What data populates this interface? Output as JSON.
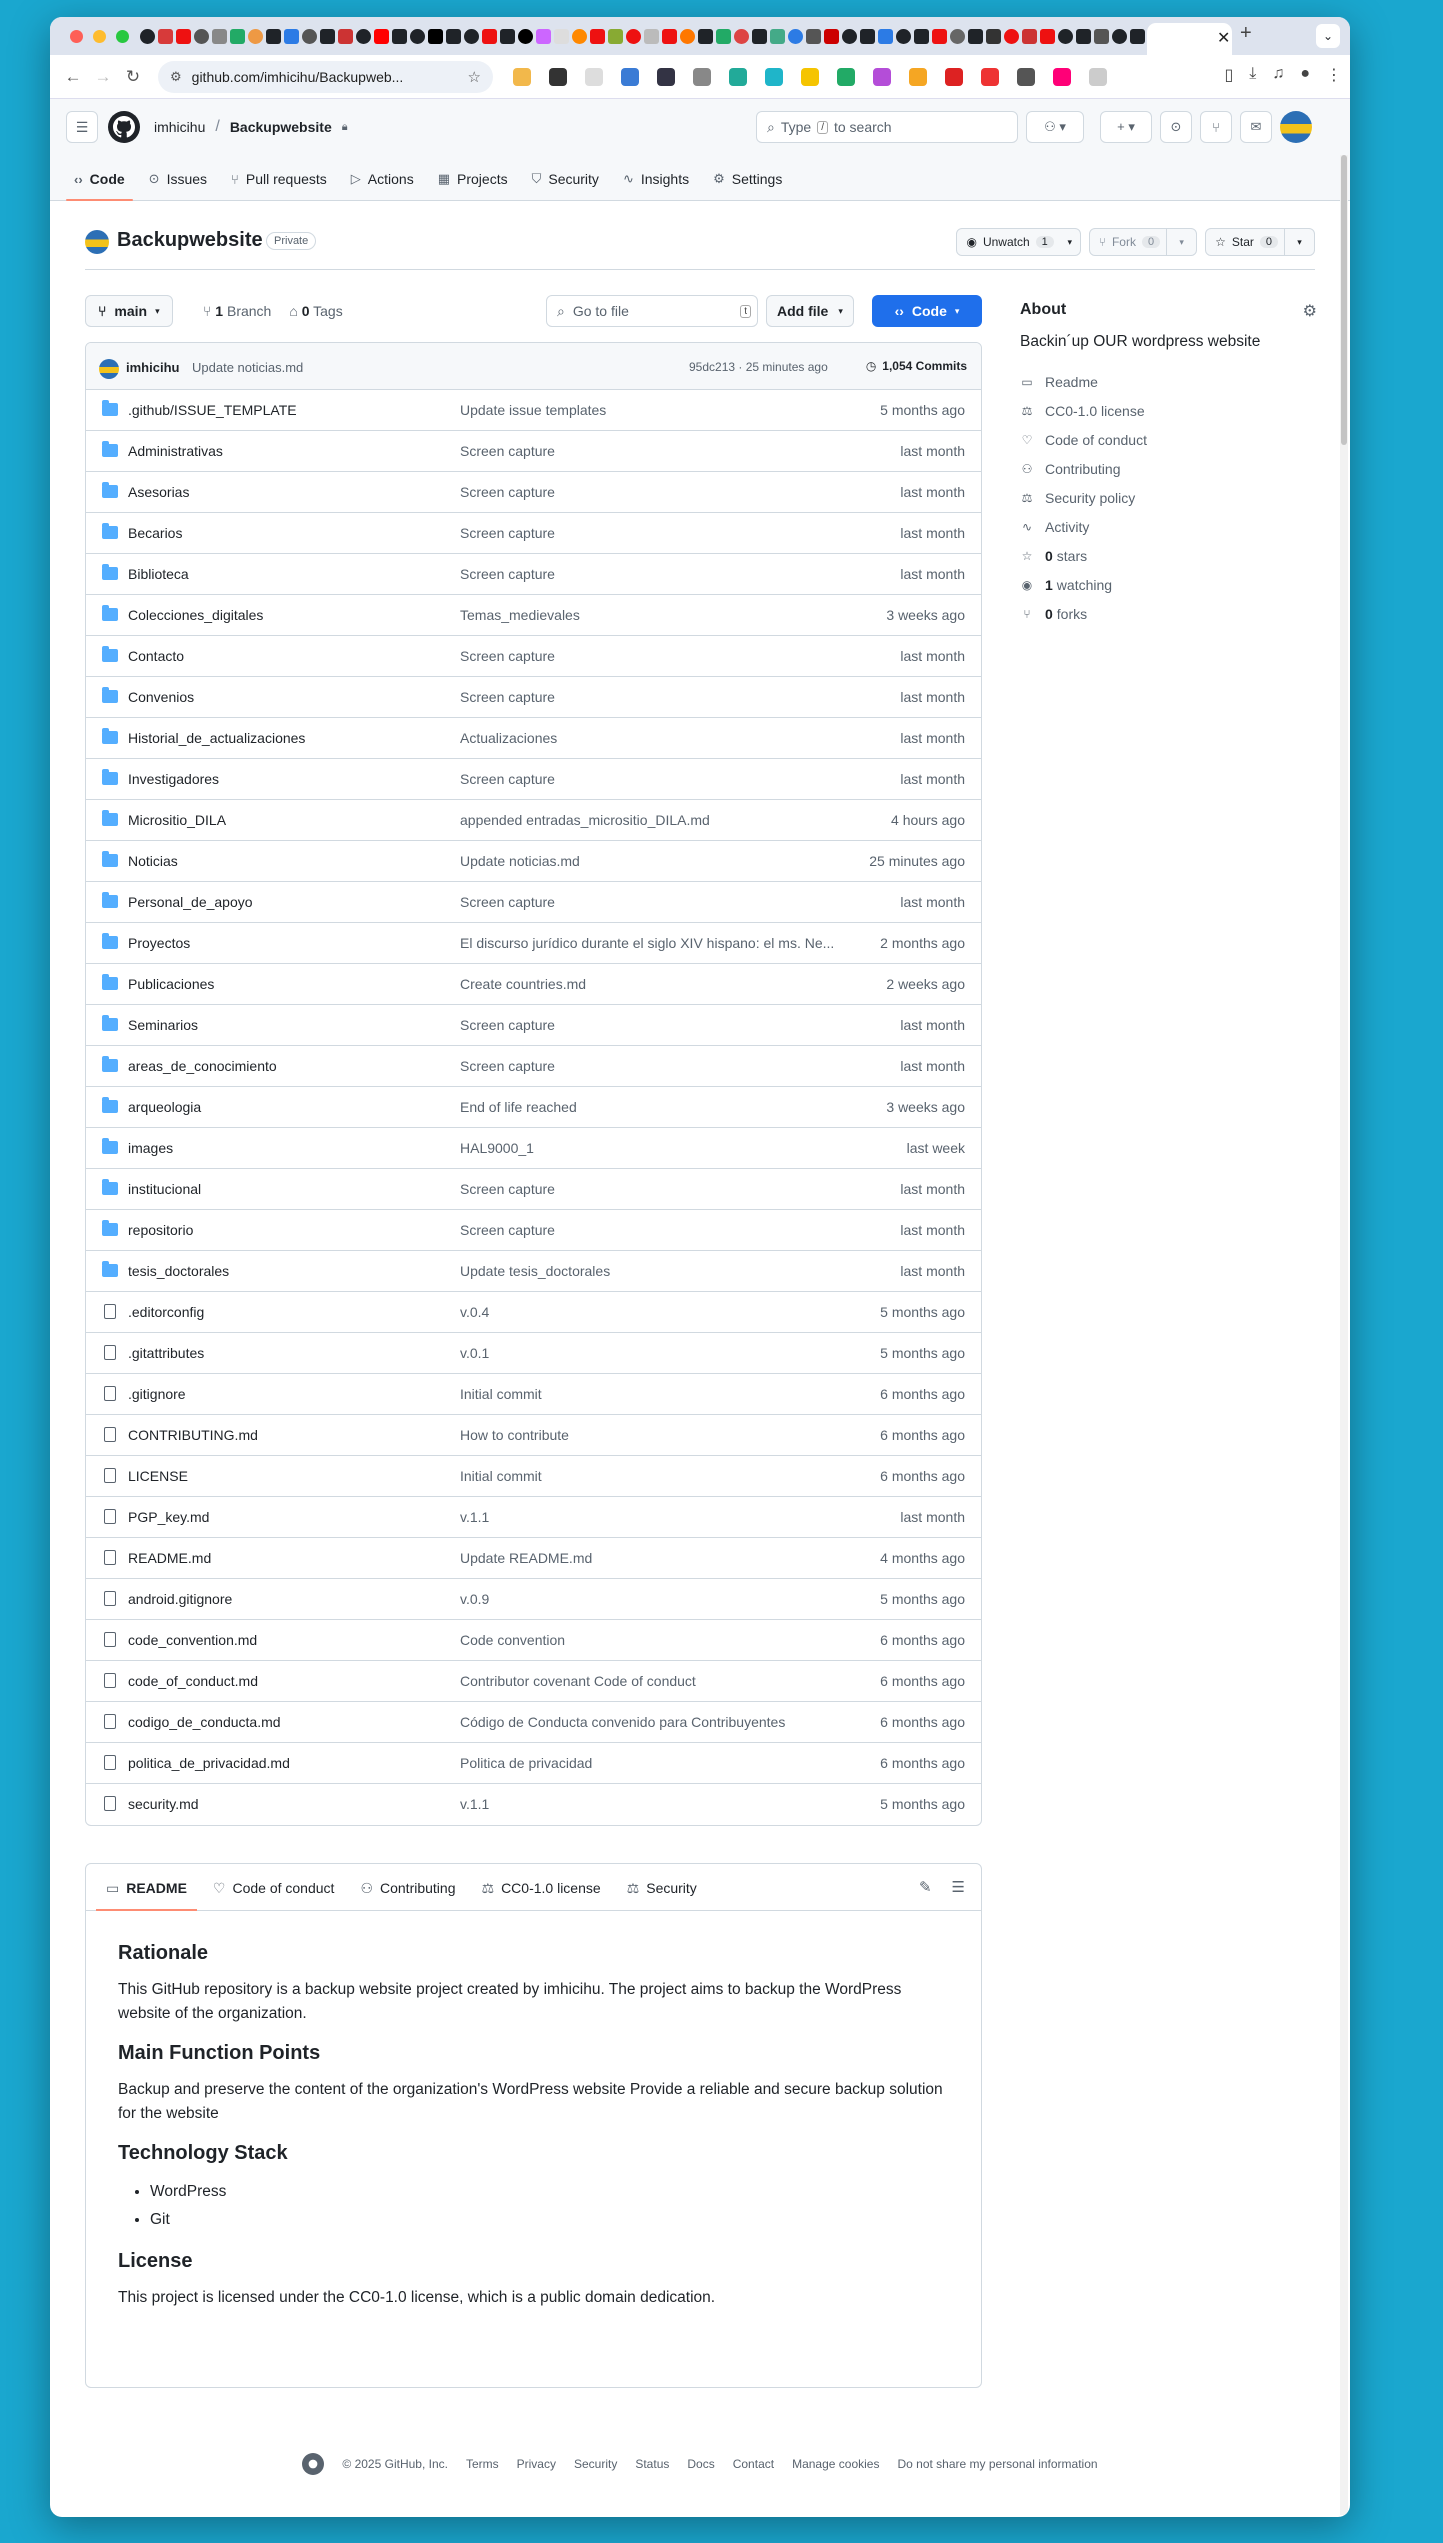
{
  "browser": {
    "url": "github.com/imhicihu/Backupweb...",
    "tab_close": "✕",
    "new_tab": "+"
  },
  "header": {
    "owner": "imhicihu",
    "separator": "/",
    "repo": "Backupwebsite",
    "search_prefix": "Type",
    "search_key": "/",
    "search_suffix": "to search"
  },
  "repo_nav": [
    "Code",
    "Issues",
    "Pull requests",
    "Actions",
    "Projects",
    "Security",
    "Insights",
    "Settings"
  ],
  "repo": {
    "name": "Backupwebsite",
    "visibility": "Private",
    "unwatch_label": "Unwatch",
    "watch_count": "1",
    "fork_label": "Fork",
    "fork_count": "0",
    "star_label": "Star",
    "star_count": "0"
  },
  "actions": {
    "branch": "main",
    "branches_count": "1",
    "branches_label": "Branch",
    "tags_count": "0",
    "tags_label": "Tags",
    "goto_placeholder": "Go to file",
    "goto_key": "t",
    "add_file": "Add file",
    "code": "Code"
  },
  "commit": {
    "user": "imhicihu",
    "message": "Update noticias.md",
    "hash_time": "95dc213 · 25 minutes ago",
    "commits": "1,054 Commits"
  },
  "files": [
    {
      "type": "dir",
      "name": ".github/ISSUE_TEMPLATE",
      "msg": "Update issue templates",
      "time": "5 months ago"
    },
    {
      "type": "dir",
      "name": "Administrativas",
      "msg": "Screen capture",
      "time": "last month"
    },
    {
      "type": "dir",
      "name": "Asesorias",
      "msg": "Screen capture",
      "time": "last month"
    },
    {
      "type": "dir",
      "name": "Becarios",
      "msg": "Screen capture",
      "time": "last month"
    },
    {
      "type": "dir",
      "name": "Biblioteca",
      "msg": "Screen capture",
      "time": "last month"
    },
    {
      "type": "dir",
      "name": "Colecciones_digitales",
      "msg": "Temas_medievales",
      "time": "3 weeks ago"
    },
    {
      "type": "dir",
      "name": "Contacto",
      "msg": "Screen capture",
      "time": "last month"
    },
    {
      "type": "dir",
      "name": "Convenios",
      "msg": "Screen capture",
      "time": "last month"
    },
    {
      "type": "dir",
      "name": "Historial_de_actualizaciones",
      "msg": "Actualizaciones",
      "time": "last month"
    },
    {
      "type": "dir",
      "name": "Investigadores",
      "msg": "Screen capture",
      "time": "last month"
    },
    {
      "type": "dir",
      "name": "Micrositio_DILA",
      "msg": "appended entradas_micrositio_DILA.md",
      "time": "4 hours ago"
    },
    {
      "type": "dir",
      "name": "Noticias",
      "msg": "Update noticias.md",
      "time": "25 minutes ago"
    },
    {
      "type": "dir",
      "name": "Personal_de_apoyo",
      "msg": "Screen capture",
      "time": "last month"
    },
    {
      "type": "dir",
      "name": "Proyectos",
      "msg": "El discurso jurídico durante el siglo XIV hispano: el ms. Ne...",
      "time": "2 months ago"
    },
    {
      "type": "dir",
      "name": "Publicaciones",
      "msg": "Create countries.md",
      "time": "2 weeks ago"
    },
    {
      "type": "dir",
      "name": "Seminarios",
      "msg": "Screen capture",
      "time": "last month"
    },
    {
      "type": "dir",
      "name": "areas_de_conocimiento",
      "msg": "Screen capture",
      "time": "last month"
    },
    {
      "type": "dir",
      "name": "arqueologia",
      "msg": "End of life reached",
      "time": "3 weeks ago"
    },
    {
      "type": "dir",
      "name": "images",
      "msg": "HAL9000_1",
      "time": "last week"
    },
    {
      "type": "dir",
      "name": "institucional",
      "msg": "Screen capture",
      "time": "last month"
    },
    {
      "type": "dir",
      "name": "repositorio",
      "msg": "Screen capture",
      "time": "last month"
    },
    {
      "type": "dir",
      "name": "tesis_doctorales",
      "msg": "Update tesis_doctorales",
      "time": "last month"
    },
    {
      "type": "file",
      "name": ".editorconfig",
      "msg": "v.0.4",
      "time": "5 months ago"
    },
    {
      "type": "file",
      "name": ".gitattributes",
      "msg": "v.0.1",
      "time": "5 months ago"
    },
    {
      "type": "file",
      "name": ".gitignore",
      "msg": "Initial commit",
      "time": "6 months ago"
    },
    {
      "type": "file",
      "name": "CONTRIBUTING.md",
      "msg": "How to contribute",
      "time": "6 months ago"
    },
    {
      "type": "file",
      "name": "LICENSE",
      "msg": "Initial commit",
      "time": "6 months ago"
    },
    {
      "type": "file",
      "name": "PGP_key.md",
      "msg": "v.1.1",
      "time": "last month"
    },
    {
      "type": "file",
      "name": "README.md",
      "msg": "Update README.md",
      "time": "4 months ago"
    },
    {
      "type": "file",
      "name": "android.gitignore",
      "msg": "v.0.9",
      "time": "5 months ago"
    },
    {
      "type": "file",
      "name": "code_convention.md",
      "msg": "Code convention",
      "time": "6 months ago"
    },
    {
      "type": "file",
      "name": "code_of_conduct.md",
      "msg": "Contributor covenant Code of conduct",
      "time": "6 months ago"
    },
    {
      "type": "file",
      "name": "codigo_de_conducta.md",
      "msg": "Código de Conducta convenido para Contribuyentes",
      "time": "6 months ago"
    },
    {
      "type": "file",
      "name": "politica_de_privacidad.md",
      "msg": "Politica de privacidad",
      "time": "6 months ago"
    },
    {
      "type": "file",
      "name": "security.md",
      "msg": "v.1.1",
      "time": "5 months ago"
    }
  ],
  "readme_tabs": [
    "README",
    "Code of conduct",
    "Contributing",
    "CC0-1.0 license",
    "Security"
  ],
  "readme": {
    "h_rationale": "Rationale",
    "p_rationale": "This GitHub repository is a backup website project created by imhicihu. The project aims to backup the WordPress website of the organization.",
    "h_main": "Main Function Points",
    "p_main": "Backup and preserve the content of the organization's WordPress website Provide a reliable and secure backup solution for the website",
    "h_stack": "Technology Stack",
    "stack": [
      "WordPress",
      "Git"
    ],
    "h_license": "License",
    "p_license": "This project is licensed under the CC0-1.0 license, which is a public domain dedication."
  },
  "about": {
    "title": "About",
    "description": "Backin´up OUR wordpress website",
    "items": [
      {
        "icon": "book-icon",
        "glyph": "▭",
        "text": "Readme"
      },
      {
        "icon": "law-icon",
        "glyph": "⚖",
        "text": "CC0-1.0 license"
      },
      {
        "icon": "heart-icon",
        "glyph": "♡",
        "text": "Code of conduct"
      },
      {
        "icon": "people-icon",
        "glyph": "⚇",
        "text": "Contributing"
      },
      {
        "icon": "law-icon",
        "glyph": "⚖",
        "text": "Security policy"
      },
      {
        "icon": "pulse-icon",
        "glyph": "∿",
        "text": "Activity"
      }
    ],
    "stars_count": "0",
    "stars_label": "stars",
    "watching_count": "1",
    "watching_label": "watching",
    "forks_count": "0",
    "forks_label": "forks"
  },
  "footer": {
    "copyright": "© 2025 GitHub, Inc.",
    "links": [
      "Terms",
      "Privacy",
      "Security",
      "Status",
      "Docs",
      "Contact",
      "Manage cookies",
      "Do not share my personal information"
    ]
  }
}
